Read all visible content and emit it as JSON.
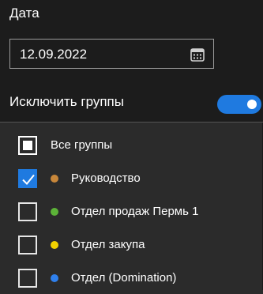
{
  "date": {
    "label": "Дата",
    "value": "12.09.2022"
  },
  "exclude_groups": {
    "label": "Исключить группы",
    "enabled": true,
    "accent": "#1f7ae0"
  },
  "groups": [
    {
      "label": "Все группы",
      "state": "indeterminate",
      "color": null
    },
    {
      "label": "Руководство",
      "state": "checked",
      "color": "#c8873a"
    },
    {
      "label": "Отдел продаж Пермь 1",
      "state": "unchecked",
      "color": "#5cb338"
    },
    {
      "label": "Отдел закупа",
      "state": "unchecked",
      "color": "#f2d200"
    },
    {
      "label": "Отдел (Domination)",
      "state": "unchecked",
      "color": "#2f80ed"
    }
  ]
}
